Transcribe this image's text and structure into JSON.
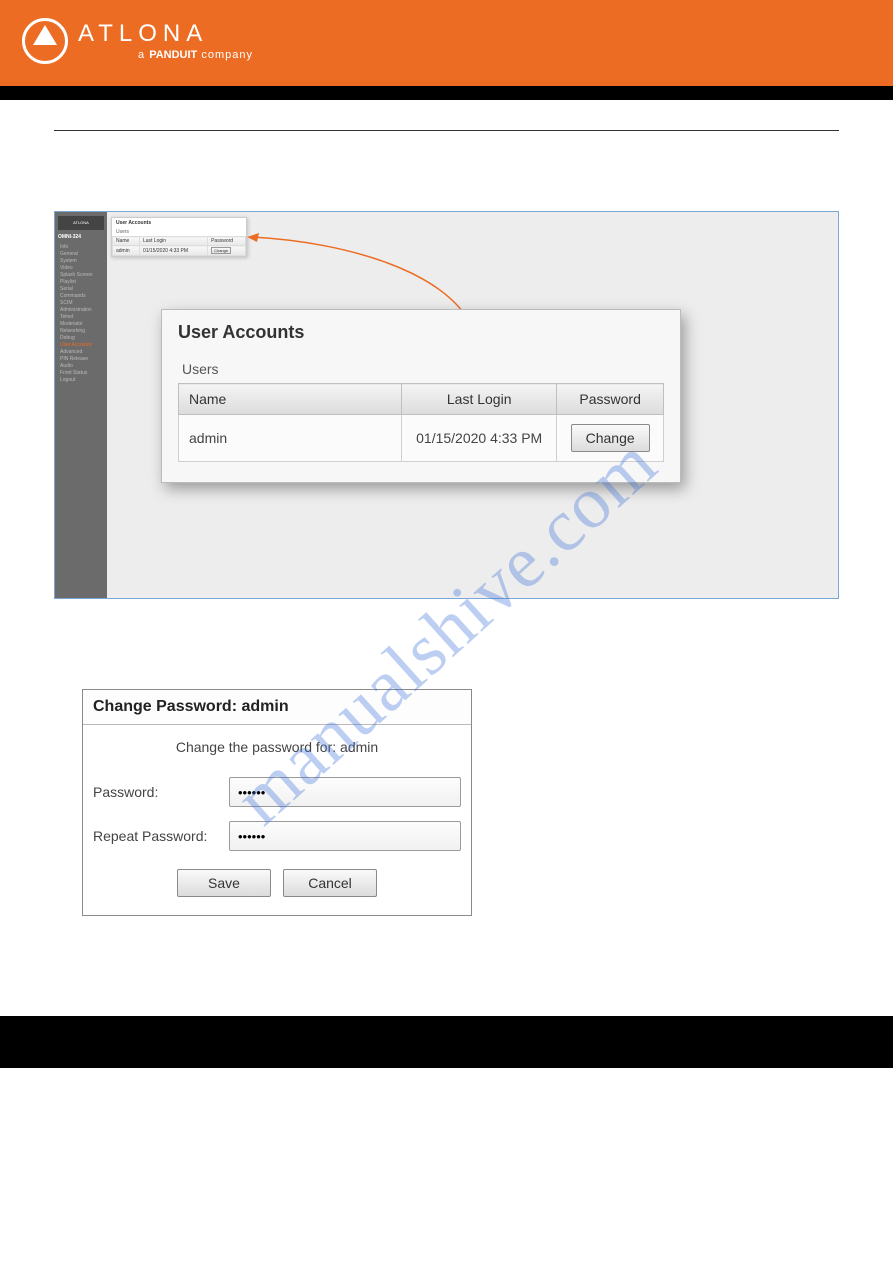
{
  "brand": {
    "name": "ATLONA",
    "tagline_prefix": "a ",
    "tagline_bold": "PANDUIT",
    "tagline_suffix": " company"
  },
  "watermark": "manualshive.com",
  "mini": {
    "logo": "ATLONA",
    "model": "OMNI-324",
    "items": [
      "Info",
      "General",
      "System",
      "Video",
      "Splash Screen",
      "Playlist",
      "Serial",
      "Commands",
      "SCIM",
      "Administration",
      "Telnet",
      "Moderator",
      "Networking",
      "Debug",
      "User Accounts",
      "Advanced",
      "PIN Release",
      "Audio",
      "Front Status",
      "Logout"
    ],
    "active_index": 14,
    "topbox": {
      "title": "User Accounts",
      "subtitle": "Users",
      "headers": [
        "Name",
        "Last Login",
        "Password"
      ],
      "row": {
        "name": "admin",
        "lastlogin": "01/15/2020 4:33 PM",
        "button": "Change"
      }
    }
  },
  "panel": {
    "title": "User Accounts",
    "section": "Users",
    "headers": {
      "name": "Name",
      "lastlogin": "Last Login",
      "password": "Password"
    },
    "row": {
      "name": "admin",
      "lastlogin": "01/15/2020 4:33 PM",
      "change": "Change"
    }
  },
  "dialog": {
    "title": "Change Password: admin",
    "message": "Change the password for: admin",
    "password_label": "Password:",
    "repeat_label": "Repeat Password:",
    "password_value": "••••••",
    "repeat_value": "••••••",
    "save": "Save",
    "cancel": "Cancel"
  }
}
